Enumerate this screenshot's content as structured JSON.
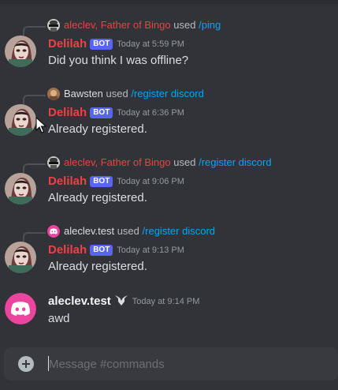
{
  "colors": {
    "background": "#313338",
    "bot_author": "#f23f43",
    "user_author": "#f2f3f5",
    "command_link": "#00a8fc",
    "bot_tag": "#5865f2",
    "timestamp": "#949ba4",
    "discord_avatar": "#eb459e"
  },
  "messages": [
    {
      "reply": {
        "avatar_icon": "sunglasses-avatar-icon",
        "user": "aleclev, Father of Bingo",
        "user_color": "#f23f43",
        "used": "used",
        "command": "/ping"
      },
      "author": "Delilah",
      "bot_tag": "BOT",
      "timestamp": "Today at 5:59 PM",
      "content": "Did you think I was offline?"
    },
    {
      "reply": {
        "avatar_icon": "bawsten-avatar-icon",
        "user": "Bawsten",
        "user_color": "#dbdee1",
        "used": "used",
        "command": "/register discord"
      },
      "author": "Delilah",
      "bot_tag": "BOT",
      "timestamp": "Today at 6:36 PM",
      "content": "Already registered."
    },
    {
      "reply": {
        "avatar_icon": "sunglasses-avatar-icon",
        "user": "aleclev, Father of Bingo",
        "user_color": "#f23f43",
        "used": "used",
        "command": "/register discord"
      },
      "author": "Delilah",
      "bot_tag": "BOT",
      "timestamp": "Today at 9:06 PM",
      "content": "Already registered."
    },
    {
      "reply": {
        "avatar_icon": "discord-avatar-icon",
        "user": "aleclev.test",
        "user_color": "#dbdee1",
        "used": "used",
        "command": "/register discord"
      },
      "author": "Delilah",
      "bot_tag": "BOT",
      "timestamp": "Today at 9:13 PM",
      "content": "Already registered."
    },
    {
      "author": "aleclev.test",
      "badge_icon": "destiny-badge-icon",
      "timestamp": "Today at 9:14 PM",
      "content": "awd"
    }
  ],
  "composer": {
    "placeholder": "Message #commands",
    "add_icon": "plus-circle-icon"
  }
}
